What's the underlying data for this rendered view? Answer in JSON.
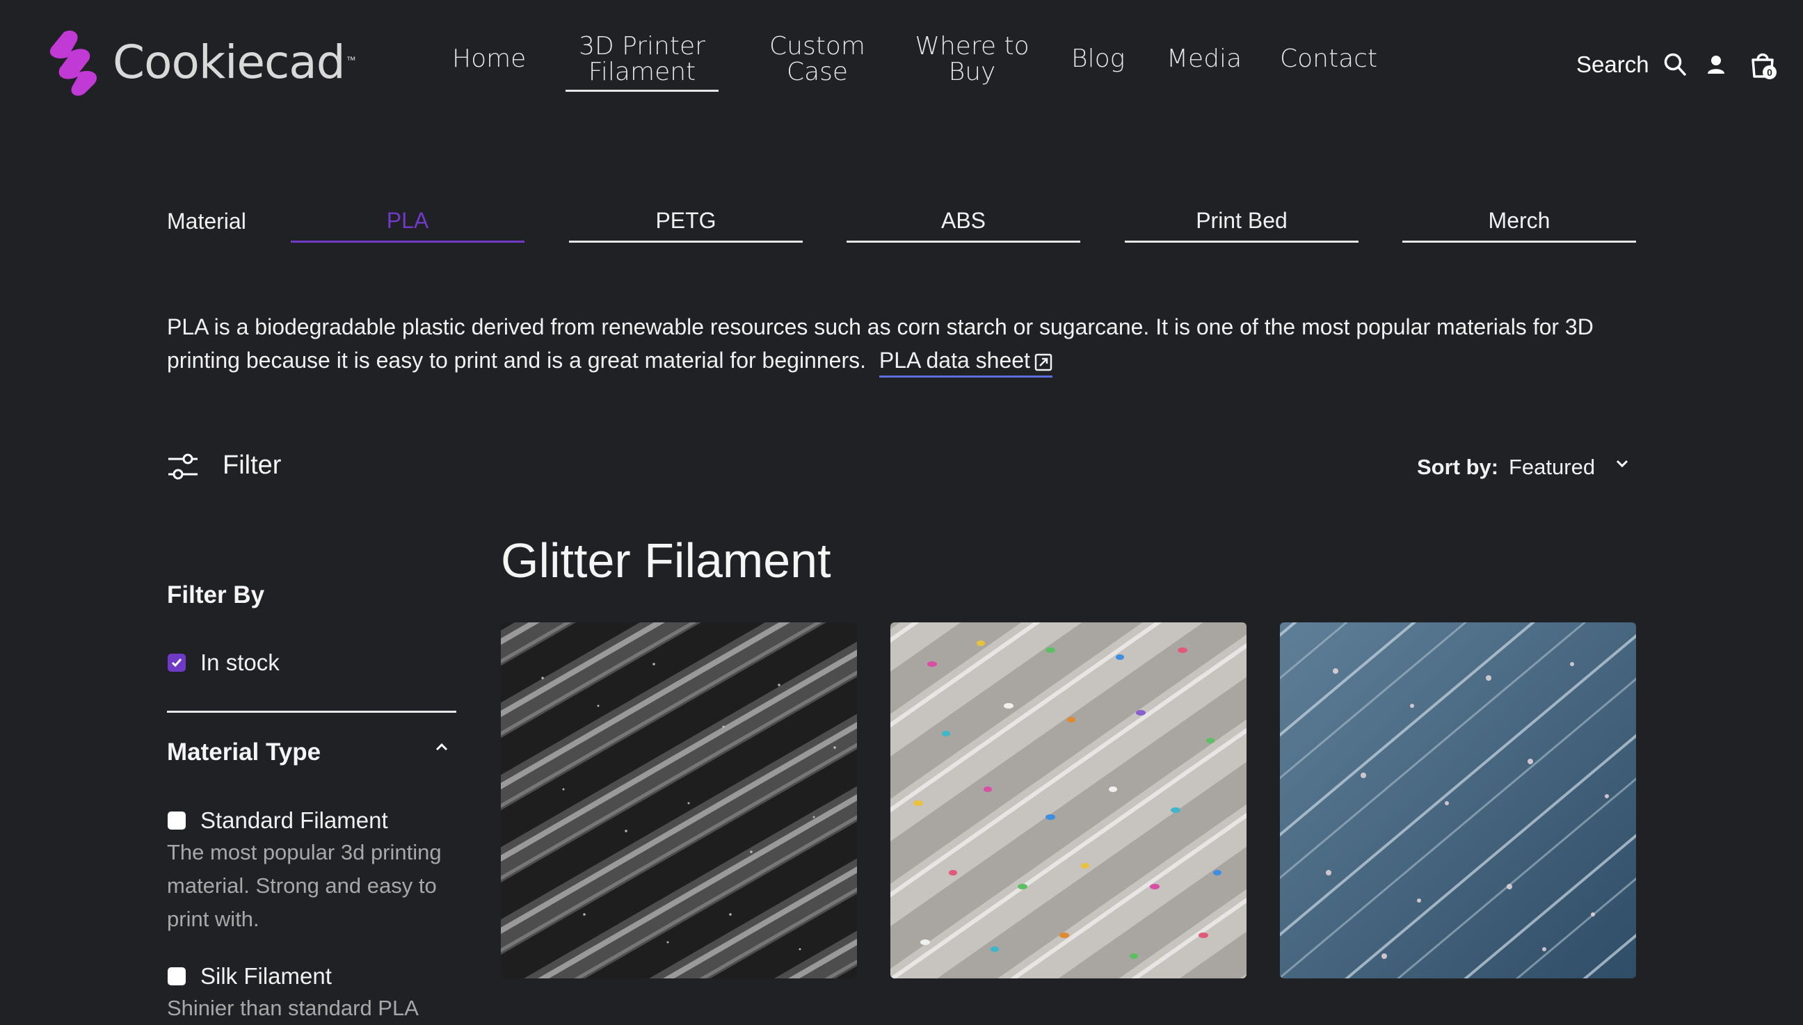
{
  "brand": {
    "name": "Cookiecad",
    "trademark": "™",
    "logo_color": "#c23ad6"
  },
  "nav": {
    "items": [
      {
        "id": "home",
        "lines": [
          "Home"
        ]
      },
      {
        "id": "filament",
        "lines": [
          "3D Printer",
          "Filament"
        ],
        "active": true
      },
      {
        "id": "custom-case",
        "lines": [
          "Custom",
          "Case"
        ]
      },
      {
        "id": "where-to-buy",
        "lines": [
          "Where to",
          "Buy"
        ]
      },
      {
        "id": "blog",
        "lines": [
          "Blog"
        ]
      },
      {
        "id": "media",
        "lines": [
          "Media"
        ]
      },
      {
        "id": "contact",
        "lines": [
          "Contact"
        ]
      }
    ],
    "search_label": "Search",
    "cart_count": "0",
    "icons": [
      "search-icon",
      "account-icon",
      "cart-icon"
    ]
  },
  "material_tabs": {
    "label": "Material",
    "tabs": [
      "PLA",
      "PETG",
      "ABS",
      "Print Bed",
      "Merch"
    ],
    "active_index": 0,
    "active_color": "#6f3ac6"
  },
  "description": {
    "text": "PLA is a biodegradable plastic derived from renewable resources such as corn starch or sugarcane. It is one of the most popular materials for 3D printing because it is easy to print and is a great material for beginners.",
    "link_label": "PLA data sheet",
    "link_color": "#5b6fe0"
  },
  "toolbar": {
    "filter_label": "Filter",
    "sort_label": "Sort by:",
    "sort_value": "Featured"
  },
  "sidebar": {
    "heading": "Filter By",
    "in_stock": {
      "label": "In stock",
      "checked": true
    },
    "material_type": {
      "heading": "Material Type",
      "expanded": true,
      "options": [
        {
          "label": "Standard Filament",
          "checked": false,
          "description": "The most popular 3d printing material. Strong and easy to print with."
        },
        {
          "label": "Silk Filament",
          "checked": false,
          "description": "Shinier than standard PLA"
        }
      ]
    }
  },
  "main": {
    "section_title": "Glitter Filament",
    "products": [
      {
        "image": "glitter-filament-black-silver",
        "tone": "#3a3a3a"
      },
      {
        "image": "glitter-filament-clear-confetti",
        "tone": "#bdb9b4"
      },
      {
        "image": "glitter-filament-clear-blue",
        "tone": "#4b6b86"
      }
    ]
  },
  "colors": {
    "background": "#202124",
    "text": "#ffffff",
    "accent": "#6f3ac6"
  }
}
